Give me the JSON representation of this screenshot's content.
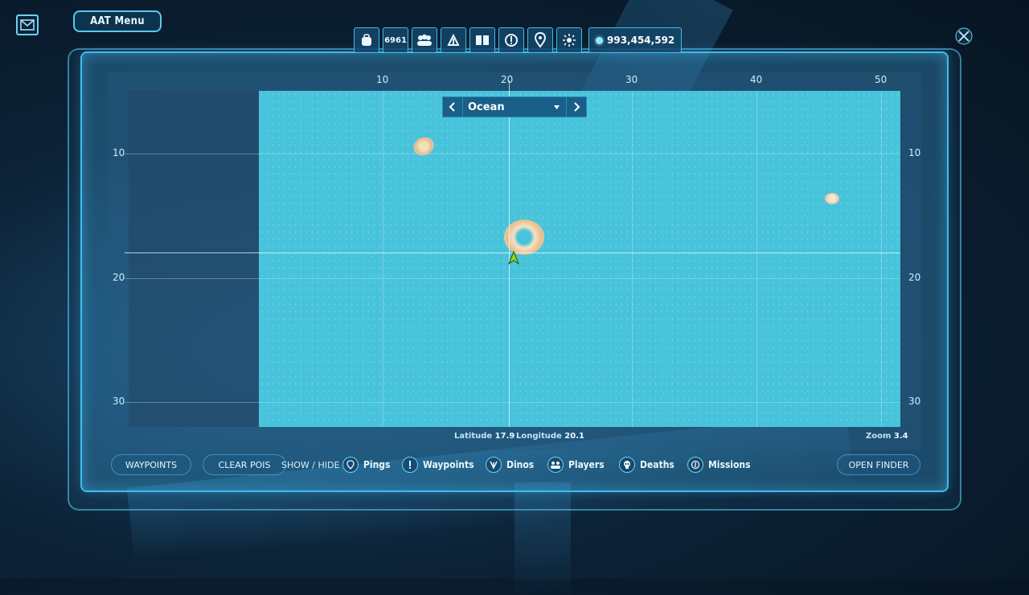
{
  "header": {
    "menu_label": "AAT Menu",
    "dino_count": "6961",
    "currency": "993,454,592"
  },
  "toolbar_icons": [
    "backpack-icon",
    "dino-count-icon",
    "tribe-icon",
    "engrams-icon",
    "book-icon",
    "waypoint-icon",
    "location-pin-icon",
    "settings-sun-icon"
  ],
  "map": {
    "region_selected": "Ocean",
    "x_ticks": [
      "10",
      "20",
      "30",
      "40",
      "50"
    ],
    "y_ticks": [
      "10",
      "20",
      "30"
    ],
    "latitude_label": "Latitude",
    "latitude_value": "17.9",
    "longitude_label": "Longitude",
    "longitude_value": "20.1",
    "zoom_label": "Zoom",
    "zoom_value": "3.4"
  },
  "bottom": {
    "waypoints_btn": "WAYPOINTS",
    "clear_pois_btn": "CLEAR POIS",
    "show_hide": "SHOW / HIDE",
    "toggles": [
      "Pings",
      "Waypoints",
      "Dinos",
      "Players",
      "Deaths",
      "Missions"
    ],
    "open_finder_btn": "OPEN FINDER"
  },
  "colors": {
    "accent": "#3fbcee",
    "ocean": "#48c3dc",
    "player_marker": "#8fd61a"
  }
}
